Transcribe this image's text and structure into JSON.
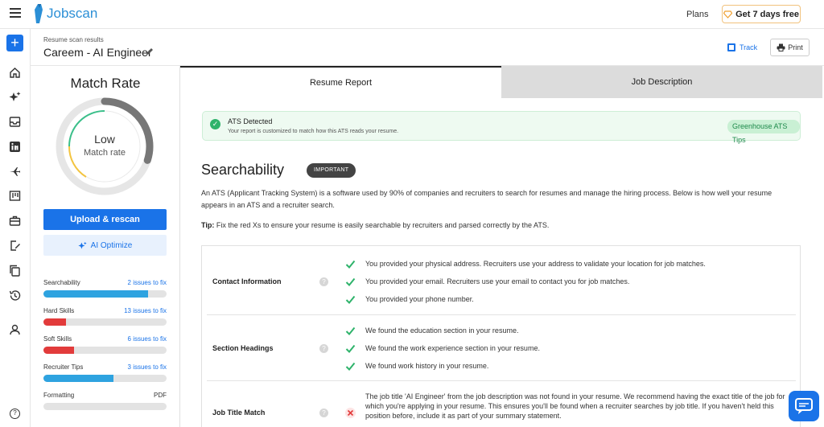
{
  "topbar": {
    "logo_text": "Jobscan",
    "plans_label": "Plans",
    "trial_label": "Get 7 days free"
  },
  "header": {
    "subtitle": "Resume scan results",
    "title": "Careem - AI Engineer",
    "track_label": "Track",
    "print_label": "Print"
  },
  "sidebar": {
    "match_rate_title": "Match Rate",
    "match_level": "Low",
    "match_label": "Match rate",
    "match_fraction": 0.3,
    "upload_label": "Upload & rescan",
    "optimize_label": "AI Optimize",
    "metrics": [
      {
        "name": "Searchability",
        "status": "2 issues to fix",
        "fill": 0.85,
        "color": "#2ea3e0"
      },
      {
        "name": "Hard Skills",
        "status": "13 issues to fix",
        "fill": 0.18,
        "color": "#e23b3b"
      },
      {
        "name": "Soft Skills",
        "status": "6 issues to fix",
        "fill": 0.25,
        "color": "#e23b3b"
      },
      {
        "name": "Recruiter Tips",
        "status": "3 issues to fix",
        "fill": 0.57,
        "color": "#2ea3e0"
      },
      {
        "name": "Formatting",
        "status": "PDF",
        "fill": 0,
        "color": "#2ea3e0"
      }
    ]
  },
  "tabs": {
    "resume_report": "Resume Report",
    "job_description": "Job Description"
  },
  "ats": {
    "title": "ATS Detected",
    "subtitle": "Your report is customized to match how this ATS reads your resume.",
    "tips_label": "Greenhouse ATS Tips"
  },
  "searchability": {
    "title": "Searchability",
    "badge": "IMPORTANT",
    "intro": "An ATS (Applicant Tracking System) is a software used by 90% of companies and recruiters to search for resumes and manage the hiring process. Below is how well your resume appears in an ATS and a recruiter search.",
    "tip_label": "Tip:",
    "tip_text": "Fix the red Xs to ensure your resume is easily searchable by recruiters and parsed correctly by the ATS.",
    "sections": [
      {
        "label": "Contact Information",
        "items": [
          {
            "ok": true,
            "text": "You provided your physical address. Recruiters use your address to validate your location for job matches."
          },
          {
            "ok": true,
            "text": "You provided your email. Recruiters use your email to contact you for job matches."
          },
          {
            "ok": true,
            "text": "You provided your phone number."
          }
        ]
      },
      {
        "label": "Section Headings",
        "items": [
          {
            "ok": true,
            "text": "We found the education section in your resume."
          },
          {
            "ok": true,
            "text": "We found the work experience section in your resume."
          },
          {
            "ok": true,
            "text": "We found work history in your resume."
          }
        ]
      },
      {
        "label": "Job Title Match",
        "items": [
          {
            "ok": false,
            "text": "The job title 'AI Engineer' from the job description was not found in your resume. We recommend having the exact title of the job for which you're applying in your resume. This ensures you'll be found when a recruiter searches by job title. If you haven't held this position before, include it as part of your summary statement."
          }
        ]
      }
    ]
  },
  "colors": {
    "brand": "#1a73e8",
    "success": "#2fb36b",
    "error": "#e23b3b"
  }
}
